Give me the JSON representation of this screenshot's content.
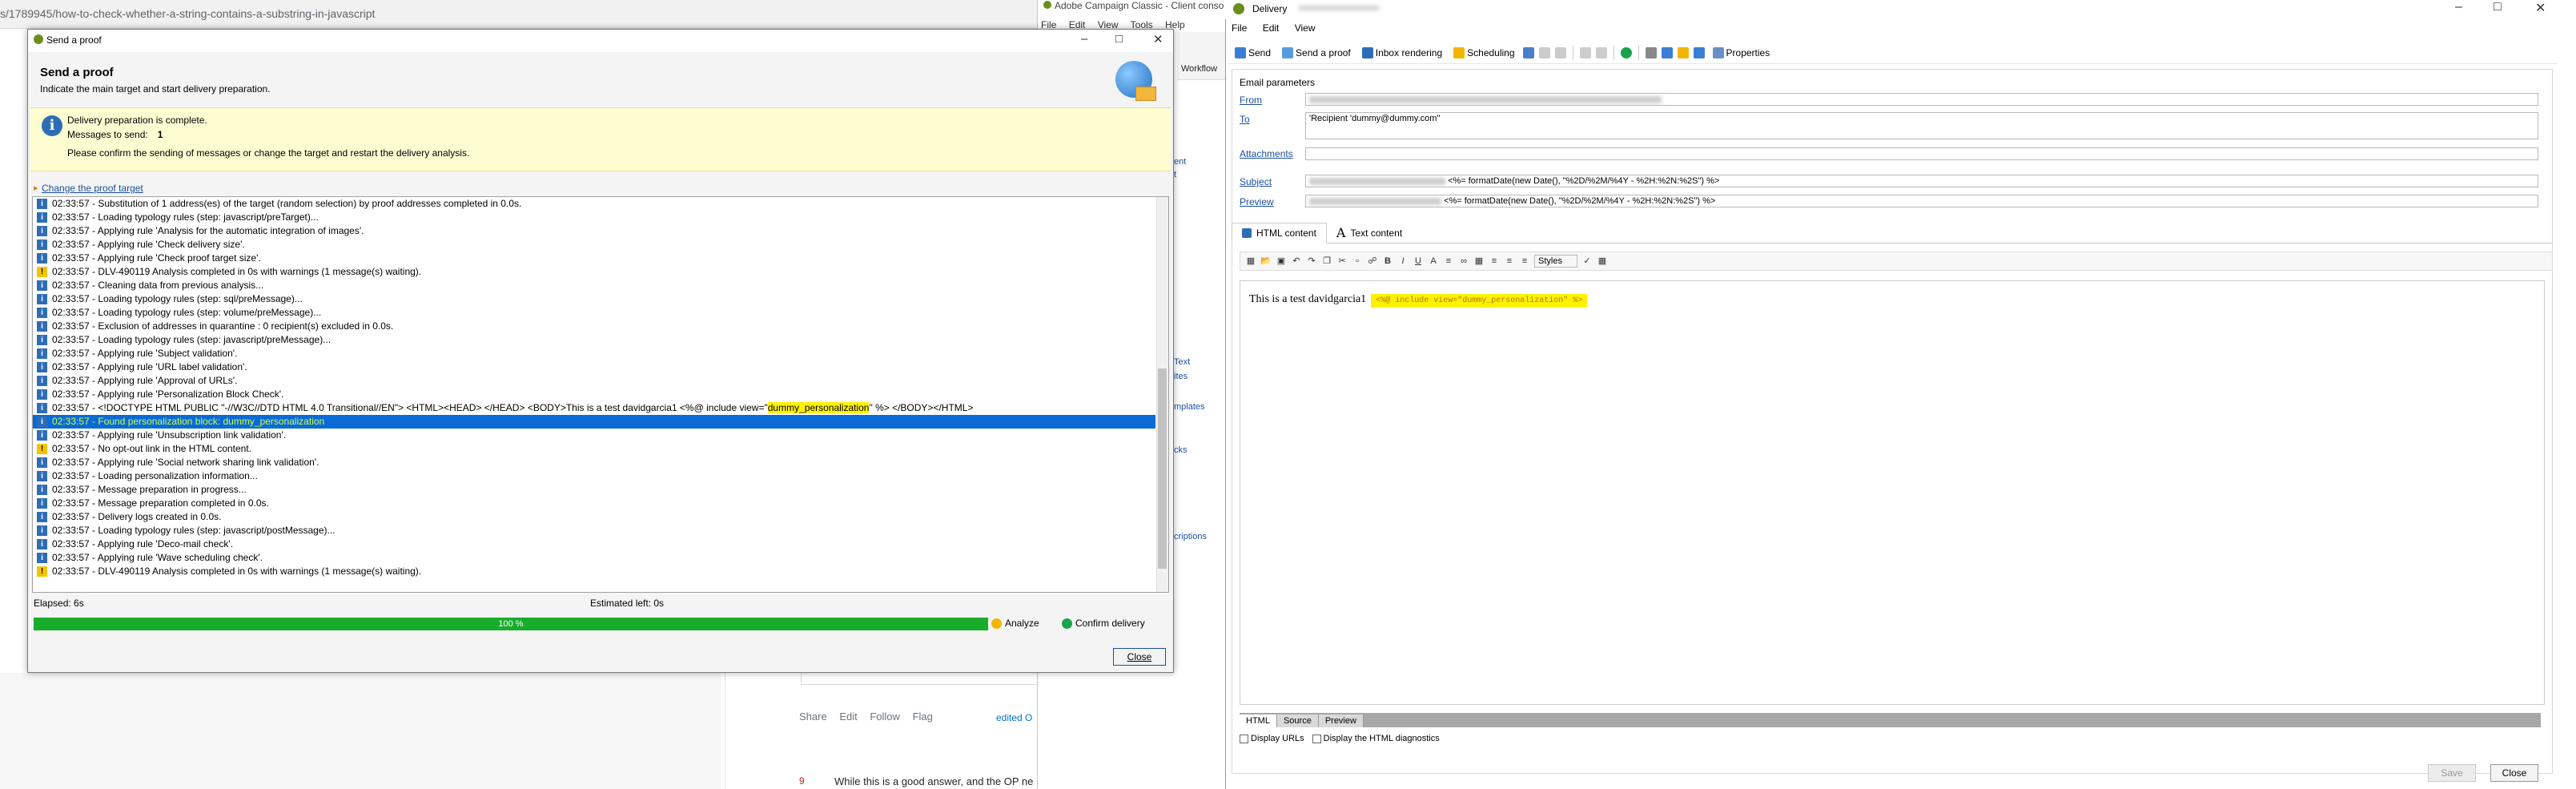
{
  "browser": {
    "url": "s/1789945/how-to-check-whether-a-string-contains-a-substring-in-javascript"
  },
  "stackoverflow": {
    "links": [
      "Share",
      "Edit",
      "Follow",
      "Flag"
    ],
    "edited": "edited O",
    "vote": "9",
    "answer_text": "While this is a good answer, and the OP ne"
  },
  "campaign_window": {
    "title": "Adobe Campaign Classic - Client conso",
    "menu": [
      "File",
      "Edit",
      "View",
      "Tools",
      "Help"
    ],
    "workflow": "Workflow",
    "nav_fragments": [
      "ent",
      "t",
      "Text",
      "ites",
      "mplates",
      "cks",
      "criptions"
    ]
  },
  "delivery": {
    "title": "Delivery",
    "menu": [
      "File",
      "Edit",
      "View"
    ],
    "toolbar": {
      "send": "Send",
      "send_proof": "Send a proof",
      "inbox_rendering": "Inbox rendering",
      "scheduling": "Scheduling",
      "properties": "Properties"
    },
    "email_params_label": "Email parameters",
    "fields": {
      "from_label": "From",
      "to_label": "To",
      "to_value": "'Recipient 'dummy@dummy.com''",
      "attachments_label": "Attachments",
      "subject_label": "Subject",
      "subject_suffix": "<%= formatDate(new Date(), \"%2D/%2M/%4Y - %2H:%2N:%2S\") %>",
      "preview_label": "Preview",
      "preview_suffix": "<%= formatDate(new Date(), \"%2D/%2M/%4Y - %2H:%2N:%2S\") %>"
    },
    "tabs": {
      "html": "HTML content",
      "text": "Text content"
    },
    "editor": {
      "styles": "Styles",
      "body_text": "This is a test davidgarcia1",
      "include_tag": "<%@ include view=\"dummy_personalization\" %>"
    },
    "bottom_tabs": [
      "HTML",
      "Source",
      "Preview"
    ],
    "checks": [
      "Display URLs",
      "Display the HTML diagnostics"
    ],
    "save": "Save",
    "close": "Close"
  },
  "send_proof": {
    "window_title": "Send a proof",
    "heading": "Send a proof",
    "subheading": "Indicate the main target and start delivery preparation.",
    "info": {
      "line1": "Delivery preparation is complete.",
      "messages_label": "Messages to send:",
      "messages_value": "1",
      "line3": "Please confirm the sending of messages or change the target and restart the delivery analysis."
    },
    "change_target": "Change the proof target",
    "log": [
      {
        "type": "info",
        "text": "02:33:57 - Substitution of 1 address(es) of the target (random selection) by proof addresses completed in 0.0s."
      },
      {
        "type": "info",
        "text": "02:33:57 - Loading typology rules (step: javascript/preTarget)..."
      },
      {
        "type": "info",
        "text": "02:33:57 - Applying rule 'Analysis for the automatic integration of images'."
      },
      {
        "type": "info",
        "text": "02:33:57 - Applying rule 'Check delivery size'."
      },
      {
        "type": "info",
        "text": "02:33:57 - Applying rule 'Check proof target size'."
      },
      {
        "type": "warn",
        "text": "02:33:57 - DLV-490119 Analysis completed in 0s with warnings (1 message(s) waiting)."
      },
      {
        "type": "info",
        "text": "02:33:57 - Cleaning data from previous analysis..."
      },
      {
        "type": "info",
        "text": "02:33:57 - Loading typology rules (step: sql/preMessage)..."
      },
      {
        "type": "info",
        "text": "02:33:57 - Loading typology rules (step: volume/preMessage)..."
      },
      {
        "type": "info",
        "text": "02:33:57 - Exclusion of addresses in quarantine : 0 recipient(s) excluded in 0.0s."
      },
      {
        "type": "info",
        "text": "02:33:57 - Loading typology rules (step: javascript/preMessage)..."
      },
      {
        "type": "info",
        "text": "02:33:57 - Applying rule 'Subject validation'."
      },
      {
        "type": "info",
        "text": "02:33:57 - Applying rule 'URL label validation'."
      },
      {
        "type": "info",
        "text": "02:33:57 - Applying rule 'Approval of URLs'."
      },
      {
        "type": "info",
        "text": "02:33:57 - Applying rule 'Personalization Block Check'."
      },
      {
        "type": "info",
        "text": "02:33:57 - <!DOCTYPE HTML PUBLIC \"-//W3C//DTD HTML 4.0 Transitional//EN\"> <HTML><HEAD> </HEAD> <BODY>This is a test davidgarcia1 <%@ include view=\"",
        "hl": "dummy_personalization",
        "after": "\" %> </BODY></HTML>"
      },
      {
        "type": "info",
        "text": "02:33:57 - Found personalization block: dummy_personalization",
        "selected": true
      },
      {
        "type": "info",
        "text": "02:33:57 - Applying rule 'Unsubscription link validation'."
      },
      {
        "type": "warn",
        "text": "02:33:57 - No opt-out link in the HTML content."
      },
      {
        "type": "info",
        "text": "02:33:57 - Applying rule 'Social network sharing link validation'."
      },
      {
        "type": "info",
        "text": "02:33:57 - Loading personalization information..."
      },
      {
        "type": "info",
        "text": "02:33:57 - Message preparation in progress..."
      },
      {
        "type": "info",
        "text": "02:33:57 - Message preparation completed in 0.0s."
      },
      {
        "type": "info",
        "text": "02:33:57 - Delivery logs created in 0.0s."
      },
      {
        "type": "info",
        "text": "02:33:57 - Loading typology rules (step: javascript/postMessage)..."
      },
      {
        "type": "info",
        "text": "02:33:57 - Applying rule 'Deco-mail check'."
      },
      {
        "type": "info",
        "text": "02:33:57 - Applying rule 'Wave scheduling check'."
      },
      {
        "type": "warn",
        "text": "02:33:57 - DLV-490119 Analysis completed in 0s with warnings (1 message(s) waiting)."
      }
    ],
    "elapsed": "Elapsed:  6s",
    "estimated_left": "Estimated left:  0s",
    "progress": {
      "label": "100 %",
      "percent": 100
    },
    "analyze": "Analyze",
    "confirm": "Confirm delivery",
    "close": "Close",
    "colors": {
      "progress": "#17ad2b",
      "selection": "#0a6ad6",
      "info_bg": "#fefdd2"
    }
  }
}
